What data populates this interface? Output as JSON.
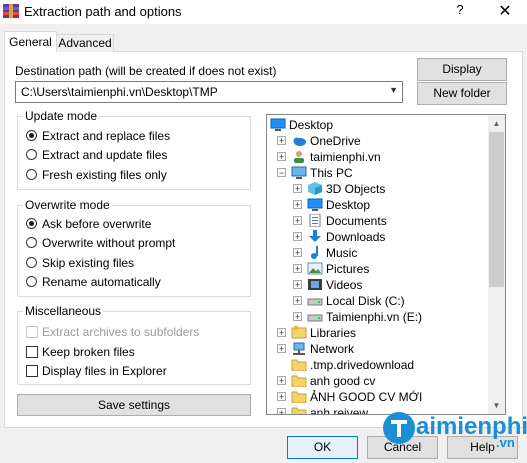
{
  "window": {
    "title": "Extraction path and options",
    "help": "?",
    "close": "✕"
  },
  "tabs": [
    {
      "label": "General"
    },
    {
      "label": "Advanced"
    }
  ],
  "destination": {
    "label": "Destination path (will be created if does not exist)",
    "value": "C:\\Users\\taimienphi.vn\\Desktop\\TMP"
  },
  "buttons": {
    "display": "Display",
    "new_folder": "New folder",
    "save_settings": "Save settings",
    "ok": "OK",
    "cancel": "Cancel",
    "help": "Help"
  },
  "update_mode": {
    "title": "Update mode",
    "options": [
      {
        "label": "Extract and replace files",
        "selected": true
      },
      {
        "label": "Extract and update files",
        "selected": false
      },
      {
        "label": "Fresh existing files only",
        "selected": false
      }
    ]
  },
  "overwrite_mode": {
    "title": "Overwrite mode",
    "options": [
      {
        "label": "Ask before overwrite",
        "selected": true
      },
      {
        "label": "Overwrite without prompt",
        "selected": false
      },
      {
        "label": "Skip existing files",
        "selected": false
      },
      {
        "label": "Rename automatically",
        "selected": false
      }
    ]
  },
  "misc": {
    "title": "Miscellaneous",
    "options": [
      {
        "label": "Extract archives to subfolders",
        "checked": false,
        "disabled": true
      },
      {
        "label": "Keep broken files",
        "checked": false,
        "disabled": false
      },
      {
        "label": "Display files in Explorer",
        "checked": false,
        "disabled": false
      }
    ]
  },
  "tree": [
    {
      "label": "Desktop",
      "icon": "desktop-icon",
      "expander": "",
      "level": 0
    },
    {
      "label": "OneDrive",
      "icon": "cloud-icon",
      "expander": "+",
      "level": 1
    },
    {
      "label": "taimienphi.vn",
      "icon": "user-icon",
      "expander": "+",
      "level": 1
    },
    {
      "label": "This PC",
      "icon": "computer-icon",
      "expander": "−",
      "level": 1
    },
    {
      "label": "3D Objects",
      "icon": "cube-icon",
      "expander": "+",
      "level": 2
    },
    {
      "label": "Desktop",
      "icon": "desktop-icon",
      "expander": "+",
      "level": 2
    },
    {
      "label": "Documents",
      "icon": "documents-icon",
      "expander": "+",
      "level": 2
    },
    {
      "label": "Downloads",
      "icon": "download-icon",
      "expander": "+",
      "level": 2
    },
    {
      "label": "Music",
      "icon": "music-icon",
      "expander": "+",
      "level": 2
    },
    {
      "label": "Pictures",
      "icon": "pictures-icon",
      "expander": "+",
      "level": 2
    },
    {
      "label": "Videos",
      "icon": "videos-icon",
      "expander": "+",
      "level": 2
    },
    {
      "label": "Local Disk (C:)",
      "icon": "drive-icon",
      "expander": "+",
      "level": 2
    },
    {
      "label": "Taimienphi.vn  (E:)",
      "icon": "drive-icon",
      "expander": "+",
      "level": 2
    },
    {
      "label": "Libraries",
      "icon": "libraries-icon",
      "expander": "+",
      "level": 1
    },
    {
      "label": "Network",
      "icon": "network-icon",
      "expander": "+",
      "level": 1
    },
    {
      "label": ".tmp.drivedownload",
      "icon": "folder-icon",
      "expander": "",
      "level": 1
    },
    {
      "label": "anh good cv",
      "icon": "folder-icon",
      "expander": "+",
      "level": 1
    },
    {
      "label": "ẢNH GOOD CV MỚI",
      "icon": "folder-icon",
      "expander": "+",
      "level": 1
    },
    {
      "label": "anh reivew",
      "icon": "folder-icon",
      "expander": "+",
      "level": 1
    }
  ],
  "watermark": {
    "brand": "aimienphi",
    "domain": ".vn"
  },
  "colors": {
    "accent": "#0078d7",
    "folder": "#f5d36b",
    "watermark": "#1a8fd6"
  }
}
